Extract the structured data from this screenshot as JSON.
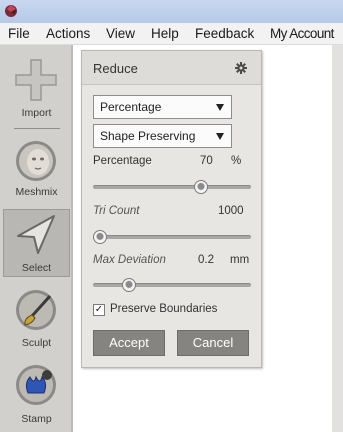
{
  "menu": {
    "items": [
      "File",
      "Actions",
      "View",
      "Help",
      "Feedback",
      "My Account"
    ]
  },
  "sidebar": {
    "tools": [
      {
        "label": "Import",
        "icon": "plus-icon"
      },
      {
        "label": "Meshmix",
        "icon": "meshmix-head-icon"
      },
      {
        "label": "Select",
        "icon": "select-arrow-icon",
        "selected": true
      },
      {
        "label": "Sculpt",
        "icon": "sculpt-brush-icon"
      },
      {
        "label": "Stamp",
        "icon": "stamp-icon"
      }
    ]
  },
  "panel": {
    "title": "Reduce",
    "reduce_mode": "Percentage",
    "reduce_type": "Shape Preserving",
    "percentage": {
      "label": "Percentage",
      "value": "70",
      "unit": "%",
      "slider_level": 0.7
    },
    "tri_count": {
      "label": "Tri Count",
      "value": "1000",
      "slider_level": 0.0
    },
    "max_deviation": {
      "label": "Max Deviation",
      "value": "0.2",
      "unit": "mm",
      "slider_level": 0.2
    },
    "preserve_boundaries": {
      "label": "Preserve Boundaries",
      "checked": true
    },
    "accept_label": "Accept",
    "cancel_label": "Cancel"
  },
  "colors": {
    "sidebar_bg": "#d2d0cc",
    "panel_bg": "#e8e6e2",
    "button_bg": "#868480",
    "titlebar": "#b6c9e8"
  }
}
